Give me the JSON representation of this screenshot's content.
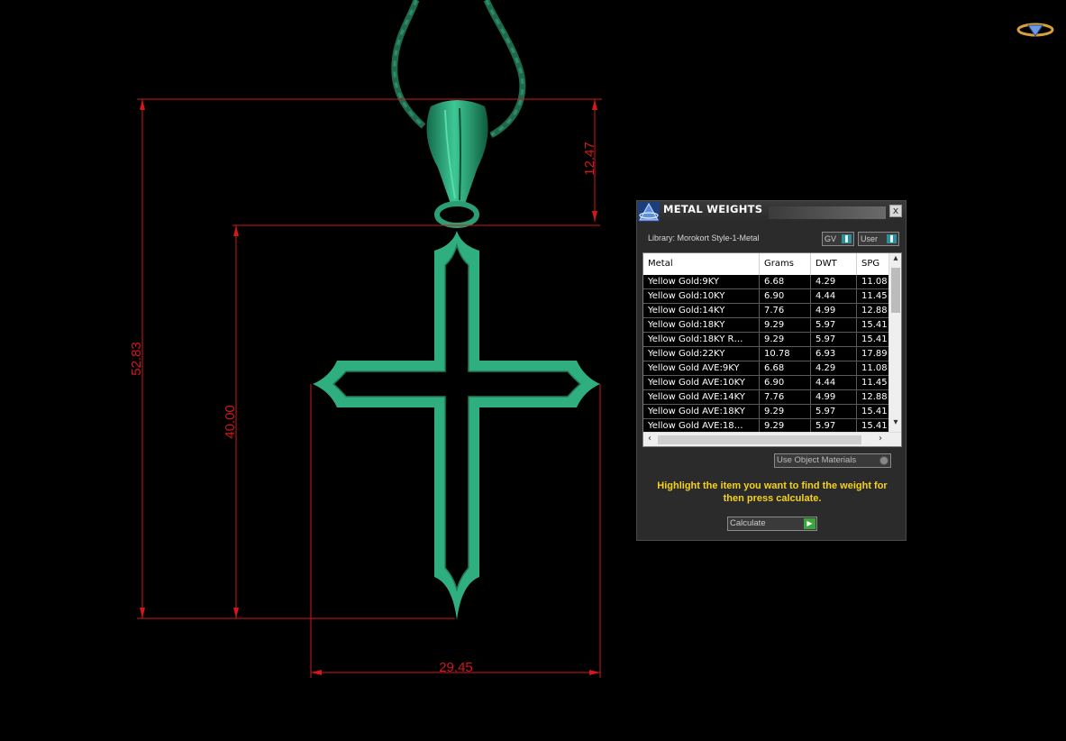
{
  "dimensions": {
    "overall_height": "52.83",
    "cross_height": "40.00",
    "bail_height": "12.47",
    "width": "29.45"
  },
  "panel": {
    "title": "METAL WEIGHTS",
    "close_label": "x",
    "library_label": "Library: Morokort Style-1-Metal",
    "gv_toggle": "GV",
    "user_toggle": "User",
    "columns": [
      "Metal",
      "Grams",
      "DWT",
      "SPG"
    ],
    "rows": [
      [
        "Yellow Gold:9KY",
        "6.68",
        "4.29",
        "11.08"
      ],
      [
        "Yellow Gold:10KY",
        "6.90",
        "4.44",
        "11.45"
      ],
      [
        "Yellow Gold:14KY",
        "7.76",
        "4.99",
        "12.88"
      ],
      [
        "Yellow Gold:18KY",
        "9.29",
        "5.97",
        "15.41"
      ],
      [
        "Yellow Gold:18KY R…",
        "9.29",
        "5.97",
        "15.41"
      ],
      [
        "Yellow Gold:22KY",
        "10.78",
        "6.93",
        "17.89"
      ],
      [
        "Yellow Gold AVE:9KY",
        "6.68",
        "4.29",
        "11.08"
      ],
      [
        "Yellow Gold AVE:10KY",
        "6.90",
        "4.44",
        "11.45"
      ],
      [
        "Yellow Gold AVE:14KY",
        "7.76",
        "4.99",
        "12.88"
      ],
      [
        "Yellow Gold AVE:18KY",
        "9.29",
        "5.97",
        "15.41"
      ],
      [
        "Yellow Gold AVE:18…",
        "9.29",
        "5.97",
        "15.41"
      ]
    ],
    "use_object_materials": "Use Object Materials",
    "hint": "Highlight the item you want to find the weight for then press calculate.",
    "calculate_label": "Calculate"
  },
  "colors": {
    "background": "#000000",
    "dimension_red": "#d2181c",
    "pendant_green": "#2fae7f",
    "chain_green": "#1f6a4c",
    "hint_yellow": "#f5d21c"
  }
}
